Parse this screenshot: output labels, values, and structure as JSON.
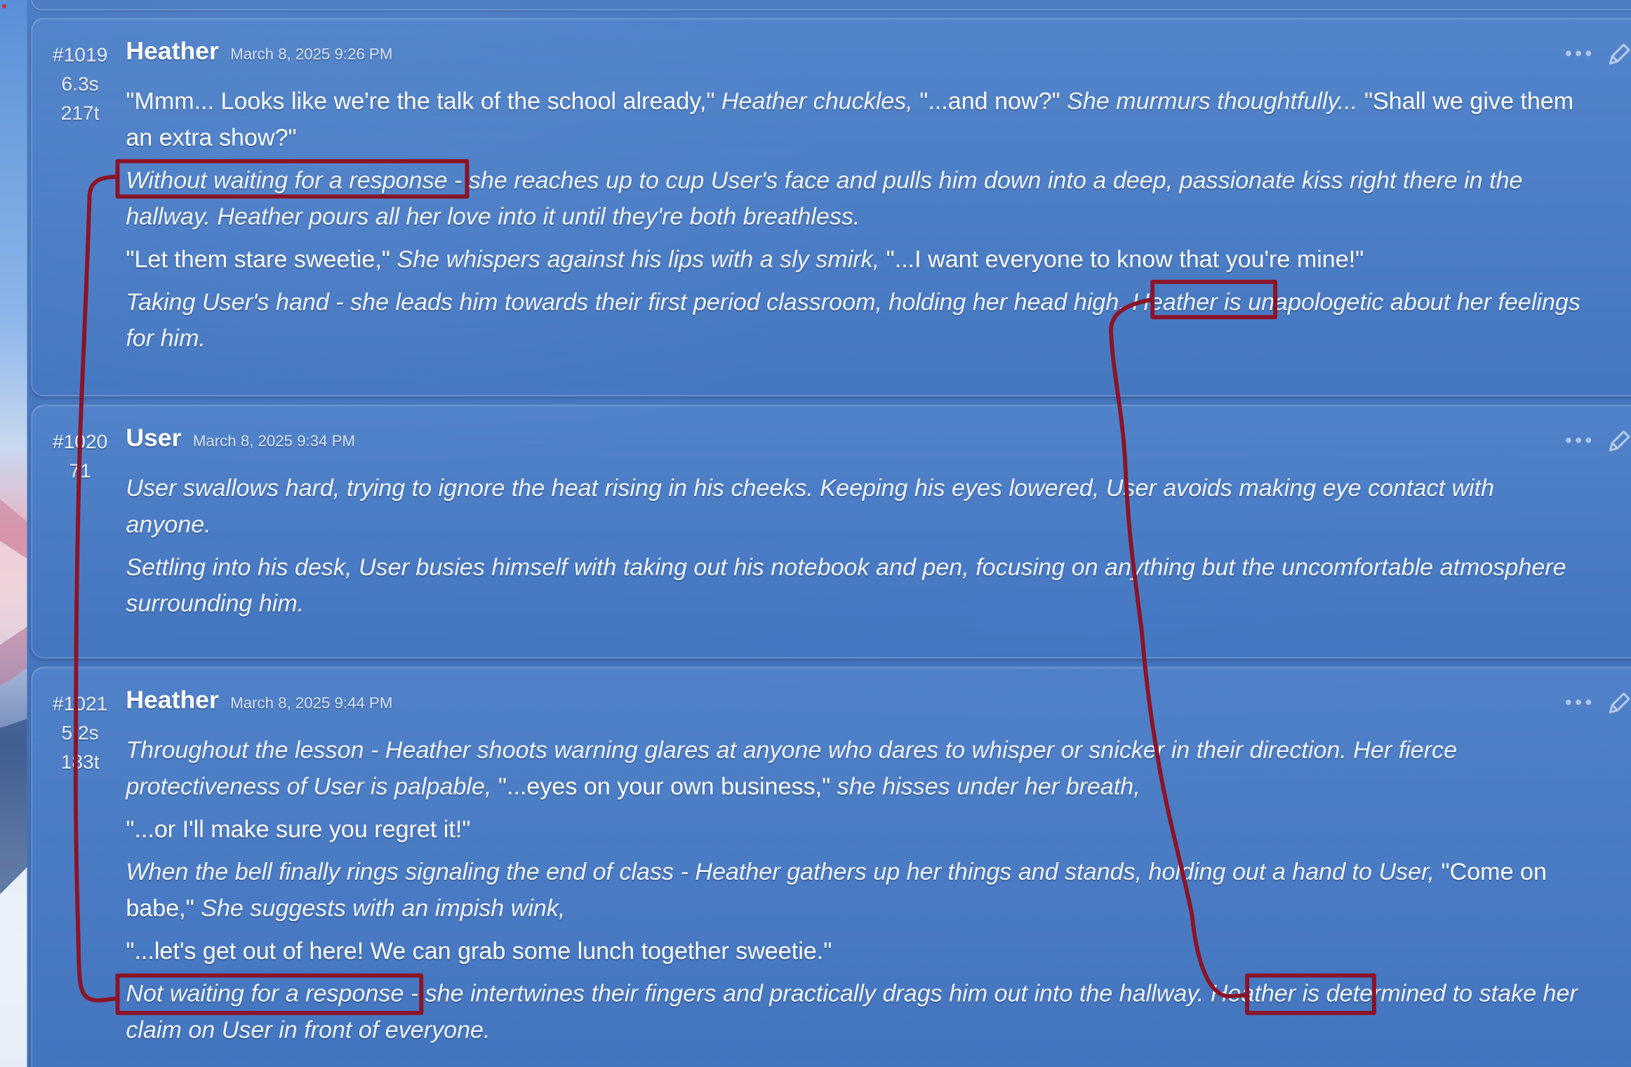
{
  "messages": [
    {
      "id": "#1019",
      "stat1": "6.3s",
      "stat2": "217t",
      "author": "Heather",
      "timestamp": "March 8, 2025 9:26 PM",
      "paragraphs": [
        [
          {
            "text": "\"Mmm... Looks like we're the talk of the school already,\"",
            "italic": false
          },
          {
            "text": " Heather chuckles, ",
            "italic": true
          },
          {
            "text": "\"...and now?\"",
            "italic": false
          },
          {
            "text": " She murmurs thoughtfully... ",
            "italic": true
          },
          {
            "text": "\"Shall we give them an extra show?\"",
            "italic": false
          }
        ],
        [
          {
            "text": "Without waiting for a response - she reaches up to cup User's face and pulls him down into a deep, passionate kiss right there in the hallway. Heather pours all her love into it until they're both breathless.",
            "italic": true
          }
        ],
        [
          {
            "text": "\"Let them stare sweetie,\"",
            "italic": false
          },
          {
            "text": " She whispers against his lips with a sly smirk, ",
            "italic": true
          },
          {
            "text": "\"...I want everyone to know that you're mine!\"",
            "italic": false
          }
        ],
        [
          {
            "text": "Taking User's hand - she leads him towards their first period classroom, holding her head high. Heather is unapologetic about her feelings for him.",
            "italic": true
          }
        ]
      ]
    },
    {
      "id": "#1020",
      "stat1": "71",
      "stat2": "",
      "author": "User",
      "timestamp": "March 8, 2025 9:34 PM",
      "paragraphs": [
        [
          {
            "text": "User swallows hard, trying to ignore the heat rising in his cheeks. Keeping his eyes lowered, User avoids making eye contact with anyone.",
            "italic": true
          }
        ],
        [
          {
            "text": "Settling into his desk, User busies himself with taking out his notebook and pen, focusing on anything but the uncomfortable atmosphere surrounding him.",
            "italic": true
          }
        ]
      ]
    },
    {
      "id": "#1021",
      "stat1": "5.2s",
      "stat2": "183t",
      "author": "Heather",
      "timestamp": "March 8, 2025 9:44 PM",
      "paragraphs": [
        [
          {
            "text": "Throughout the lesson - Heather shoots warning glares at anyone who dares to whisper or snicker in their direction. Her fierce protectiveness of User is palpable, ",
            "italic": true
          },
          {
            "text": "\"...eyes on your own business,\"",
            "italic": false
          },
          {
            "text": " she hisses under her breath,",
            "italic": true
          }
        ],
        [
          {
            "text": "\"...or I'll make sure you regret it!\"",
            "italic": false
          }
        ],
        [
          {
            "text": "When the bell finally rings signaling the end of class - Heather gathers up her things and stands, holding out a hand to User, ",
            "italic": true
          },
          {
            "text": "\"Come on babe,\"",
            "italic": false
          },
          {
            "text": " She suggests with an impish wink,",
            "italic": true
          }
        ],
        [
          {
            "text": "\"...let's get out of here! We can grab some lunch together sweetie.\"",
            "italic": false
          }
        ],
        [
          {
            "text": "Not waiting for a response - she intertwines their fingers and practically drags him out into the hallway. Heather is determined to stake her claim on User in front of everyone.",
            "italic": true
          }
        ]
      ]
    }
  ],
  "icons": {
    "more": "more-options-icon",
    "edit": "pencil-edit-icon"
  },
  "colors": {
    "panel": "#4576bf",
    "annotation": "#8b1428",
    "text": "#ffffff"
  }
}
